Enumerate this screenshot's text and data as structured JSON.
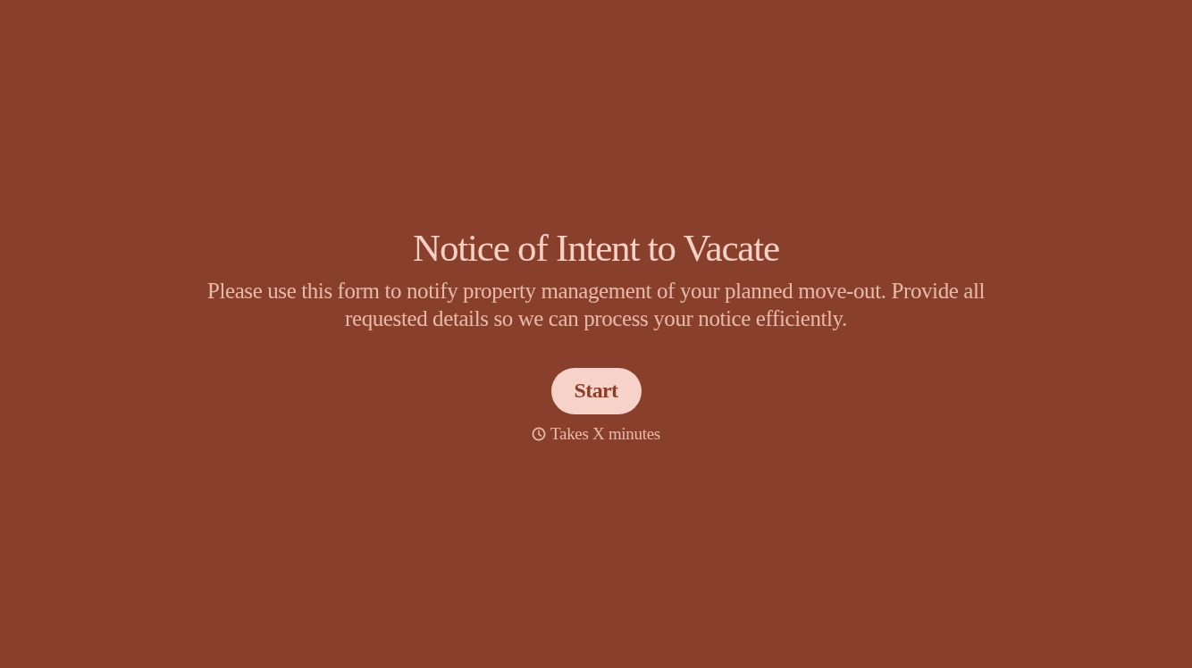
{
  "title": "Notice of Intent to Vacate",
  "description": "Please use this form to notify property management of your planned move-out. Provide all requested details so we can process your notice efficiently.",
  "start_button": {
    "label": "Start"
  },
  "duration": {
    "text": "Takes X minutes"
  }
}
